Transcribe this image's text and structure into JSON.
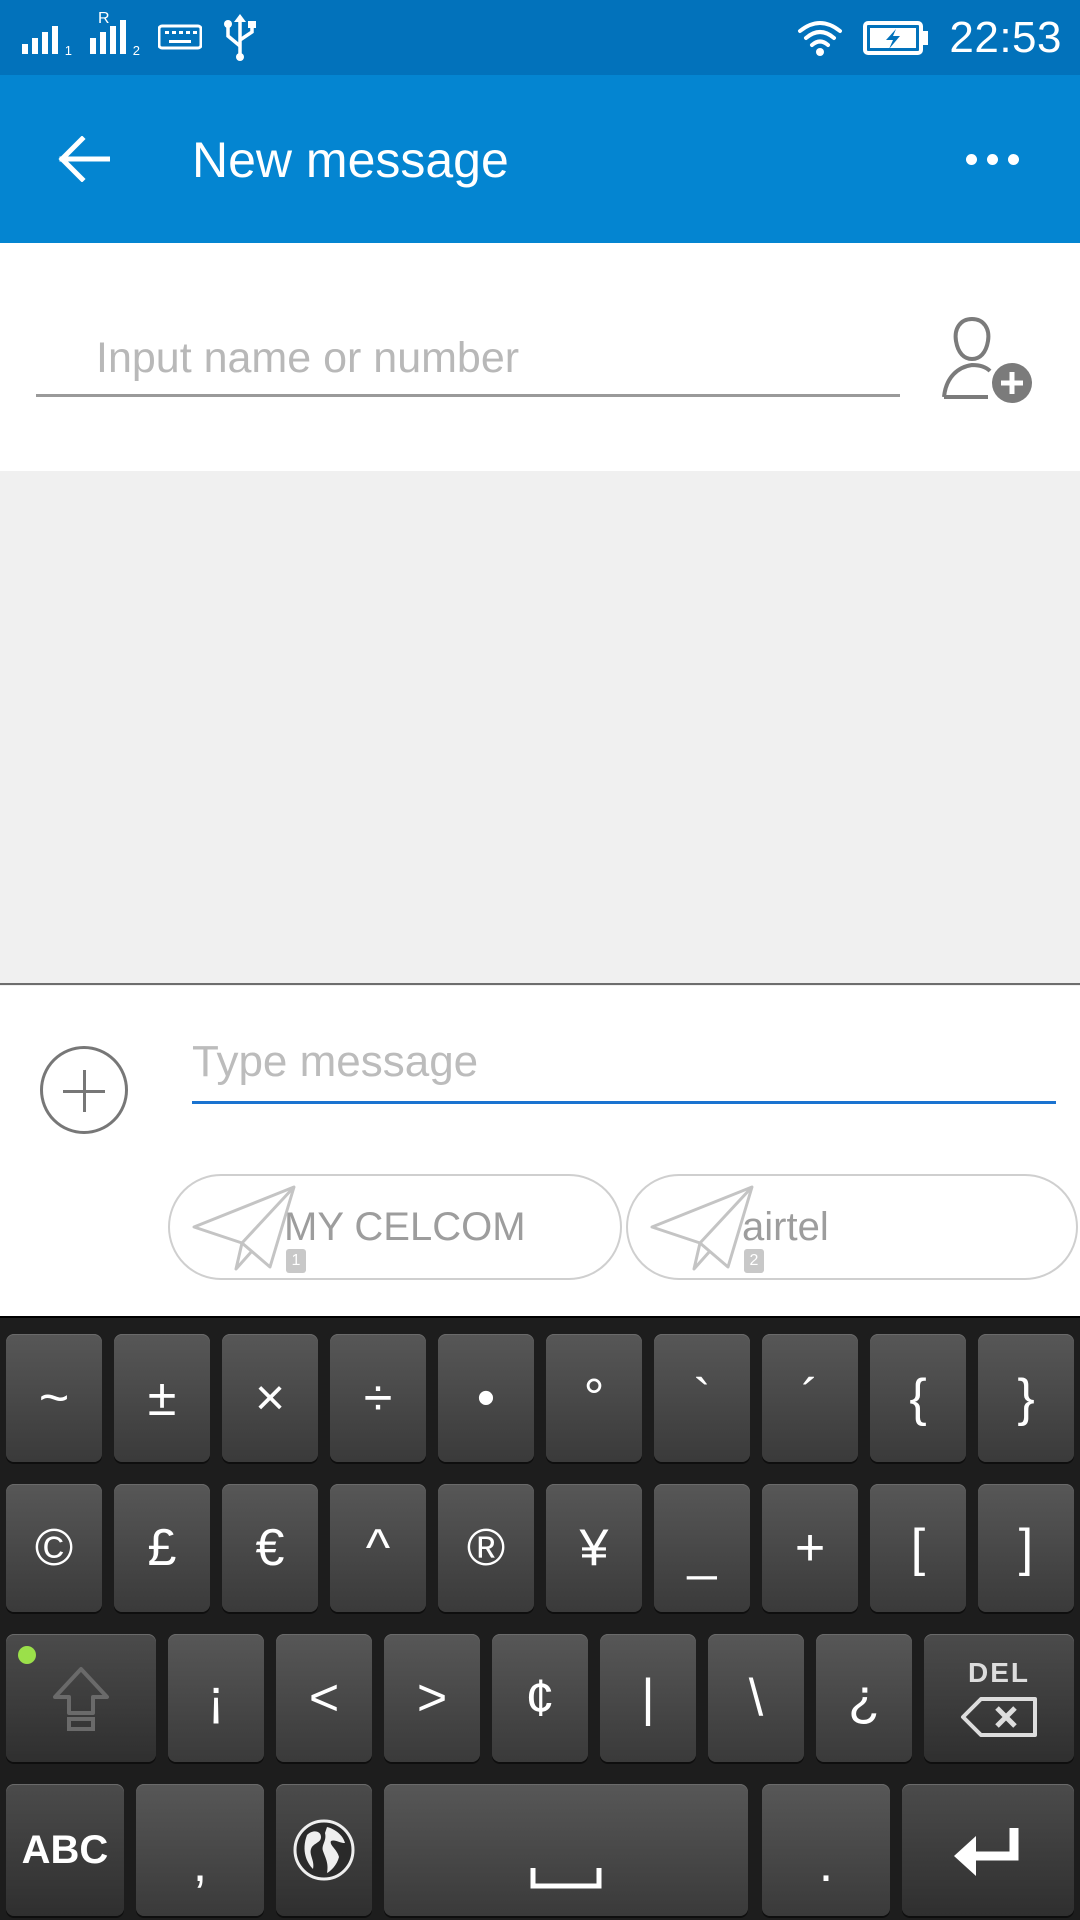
{
  "status_bar": {
    "time": "22:53",
    "sim1_sub": "1",
    "sim2_sub": "2",
    "roaming": "R"
  },
  "app_bar": {
    "title": "New message",
    "back_icon": "arrow-left-icon",
    "more_icon": "more-horizontal-icon",
    "background": "#0485d1",
    "status_background": "#0272bb"
  },
  "recipient": {
    "placeholder": "Input name or number",
    "value": "",
    "add_contact_icon": "add-contact-icon"
  },
  "compose": {
    "placeholder": "Type message",
    "value": "",
    "accent": "#1a73d0",
    "send_buttons": [
      {
        "label": "MY CELCOM",
        "sim": "1"
      },
      {
        "label": "airtel",
        "sim": "2"
      }
    ]
  },
  "keyboard": {
    "row1": [
      "~",
      "±",
      "×",
      "÷",
      "•",
      "°",
      "`",
      "´",
      "{",
      "}"
    ],
    "row2": [
      "©",
      "£",
      "€",
      "^",
      "®",
      "¥",
      "_",
      "+",
      "[",
      "]"
    ],
    "row3": [
      "¡",
      "<",
      ">",
      "¢",
      "|",
      "\\",
      "¿"
    ],
    "del_label": "DEL",
    "abc_label": "ABC",
    "comma": ",",
    "period": ".",
    "space": "␣"
  }
}
